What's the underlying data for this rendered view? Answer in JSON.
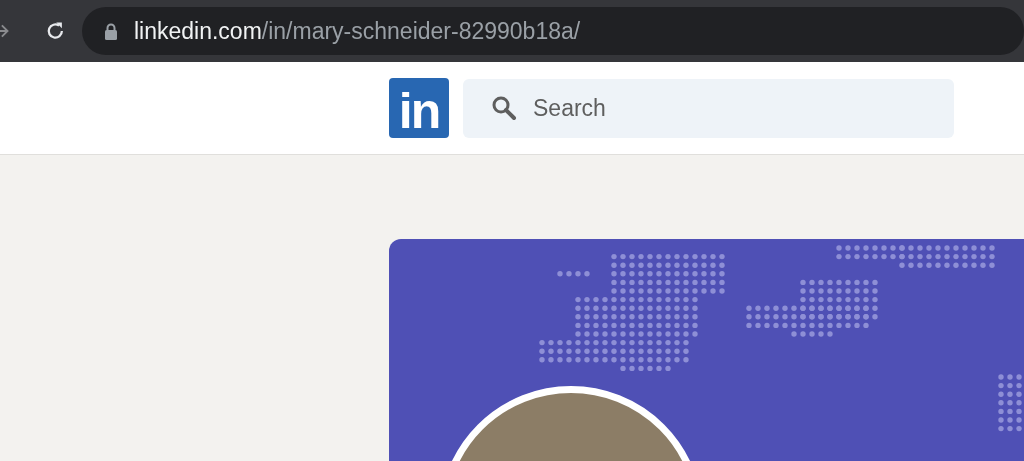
{
  "browser": {
    "url": {
      "host": "linkedin.com",
      "path": "/in/mary-schneider-82990b18a/"
    }
  },
  "header": {
    "logo": "in",
    "search": {
      "placeholder": "Search"
    }
  }
}
